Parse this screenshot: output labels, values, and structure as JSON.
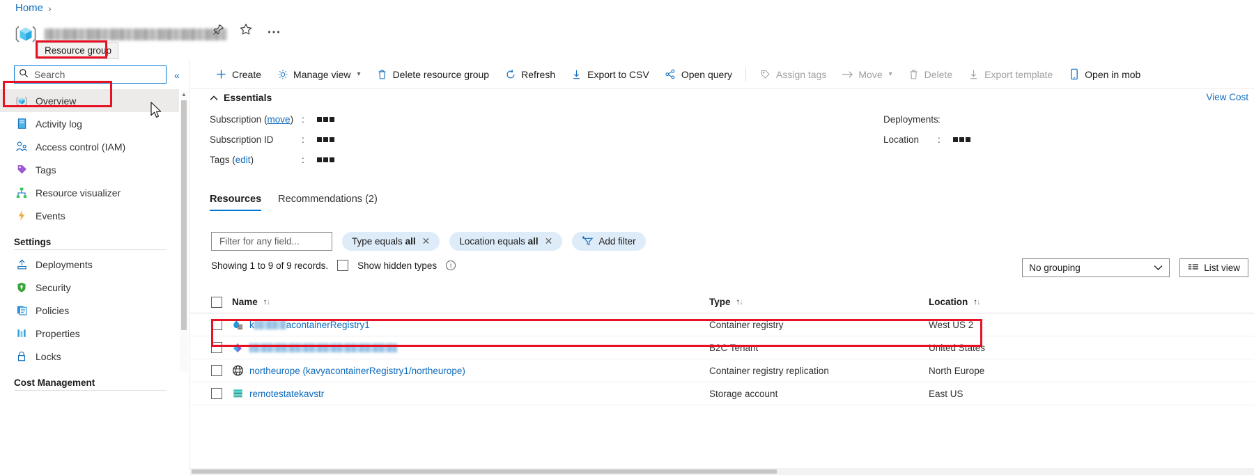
{
  "breadcrumb": {
    "home": "Home",
    "separator": "›"
  },
  "header": {
    "title_redacted": "",
    "tooltip": "Resource group",
    "pin_icon": "pin-icon",
    "favorite_icon": "star-icon",
    "more_icon": "ellipsis-icon"
  },
  "sidebar": {
    "search_placeholder": "Search",
    "collapse_label": "«",
    "items": [
      {
        "label": "Overview",
        "icon": "resource-group-icon",
        "selected": true
      },
      {
        "label": "Activity log",
        "icon": "activity-log-icon",
        "selected": false
      },
      {
        "label": "Access control (IAM)",
        "icon": "access-control-icon",
        "selected": false
      },
      {
        "label": "Tags",
        "icon": "tag-icon",
        "selected": false
      },
      {
        "label": "Resource visualizer",
        "icon": "resource-visualizer-icon",
        "selected": false
      },
      {
        "label": "Events",
        "icon": "events-lightning-icon",
        "selected": false
      }
    ],
    "groups": [
      {
        "title": "Settings",
        "items": [
          {
            "label": "Deployments",
            "icon": "deployments-icon"
          },
          {
            "label": "Security",
            "icon": "security-shield-icon"
          },
          {
            "label": "Policies",
            "icon": "policies-icon"
          },
          {
            "label": "Properties",
            "icon": "properties-icon"
          },
          {
            "label": "Locks",
            "icon": "lock-icon"
          }
        ]
      },
      {
        "title": "Cost Management",
        "items": []
      }
    ]
  },
  "toolbar": {
    "items": [
      {
        "label": "Create",
        "icon": "plus-icon",
        "disabled": false,
        "chevron": false
      },
      {
        "label": "Manage view",
        "icon": "gear-icon",
        "disabled": false,
        "chevron": true
      },
      {
        "label": "Delete resource group",
        "icon": "trash-icon",
        "disabled": false,
        "chevron": false
      },
      {
        "label": "Refresh",
        "icon": "refresh-icon",
        "disabled": false,
        "chevron": false
      },
      {
        "label": "Export to CSV",
        "icon": "download-icon",
        "disabled": false,
        "chevron": false
      },
      {
        "label": "Open query",
        "icon": "open-query-icon",
        "disabled": false,
        "chevron": false
      },
      {
        "separator": true
      },
      {
        "label": "Assign tags",
        "icon": "tag-icon",
        "disabled": true,
        "chevron": false
      },
      {
        "label": "Move",
        "icon": "arrow-right-icon",
        "disabled": true,
        "chevron": true
      },
      {
        "label": "Delete",
        "icon": "trash-icon",
        "disabled": true,
        "chevron": false
      },
      {
        "label": "Export template",
        "icon": "download-icon",
        "disabled": true,
        "chevron": false
      },
      {
        "label": "Open in mob",
        "icon": "mobile-icon",
        "disabled": false,
        "chevron": false
      }
    ]
  },
  "essentials": {
    "title": "Essentials",
    "collapse_icon": "chevron-up-icon",
    "view_cost": "View Cost",
    "left": [
      {
        "key": "Subscription",
        "link": "move",
        "colon": ":",
        "value_redacted": true
      },
      {
        "key": "Subscription ID",
        "link": "",
        "colon": ":",
        "value_redacted": true
      },
      {
        "key": "Tags",
        "link": "edit",
        "colon": ":",
        "value_redacted": true
      }
    ],
    "right": [
      {
        "key": "Deployments",
        "colon": ":",
        "value_redacted": false
      },
      {
        "key": "Location",
        "colon": ":",
        "value_redacted": true
      }
    ]
  },
  "tabs": [
    {
      "label": "Resources",
      "active": true
    },
    {
      "label": "Recommendations (2)",
      "active": false
    }
  ],
  "filters": {
    "field_placeholder": "Filter for any field...",
    "pills": [
      {
        "prefix": "Type equals ",
        "value": "all",
        "close": "✕"
      },
      {
        "prefix": "Location equals ",
        "value": "all",
        "close": "✕"
      }
    ],
    "add_filter": "Add filter"
  },
  "listinfo": {
    "showing": "Showing 1 to 9 of 9 records.",
    "show_hidden": "Show hidden types",
    "info_icon": "info-icon",
    "grouping": "No grouping",
    "list_view": "List view"
  },
  "table": {
    "columns": [
      {
        "label": "Name",
        "sort": "↑↓"
      },
      {
        "label": "Type",
        "sort": "↑↓"
      },
      {
        "label": "Location",
        "sort": "↑↓"
      }
    ],
    "rows": [
      {
        "name": "acontainerRegistry1",
        "name_prefix": "k",
        "name_masked": true,
        "fully_masked": false,
        "icon": "container-registry-icon",
        "type": "Container registry",
        "location": "West US 2",
        "highlighted": true
      },
      {
        "name": "",
        "name_prefix": "",
        "name_masked": true,
        "fully_masked": true,
        "icon": "b2c-tenant-icon",
        "type": "B2C Tenant",
        "location": "United States",
        "highlighted": false
      },
      {
        "name": "northeurope (kavyacontainerRegistry1/northeurope)",
        "name_prefix": "",
        "name_masked": false,
        "fully_masked": false,
        "icon": "globe-icon",
        "type": "Container registry replication",
        "location": "North Europe",
        "highlighted": false
      },
      {
        "name": "remotestatekavstr",
        "name_prefix": "",
        "name_masked": false,
        "fully_masked": false,
        "icon": "storage-account-icon",
        "type": "Storage account",
        "location": "East US",
        "highlighted": false
      }
    ]
  },
  "colors": {
    "accent": "#0078d4",
    "link": "#0f6cbd",
    "highlight": "#e81123",
    "selected_row": "#edebe9"
  }
}
